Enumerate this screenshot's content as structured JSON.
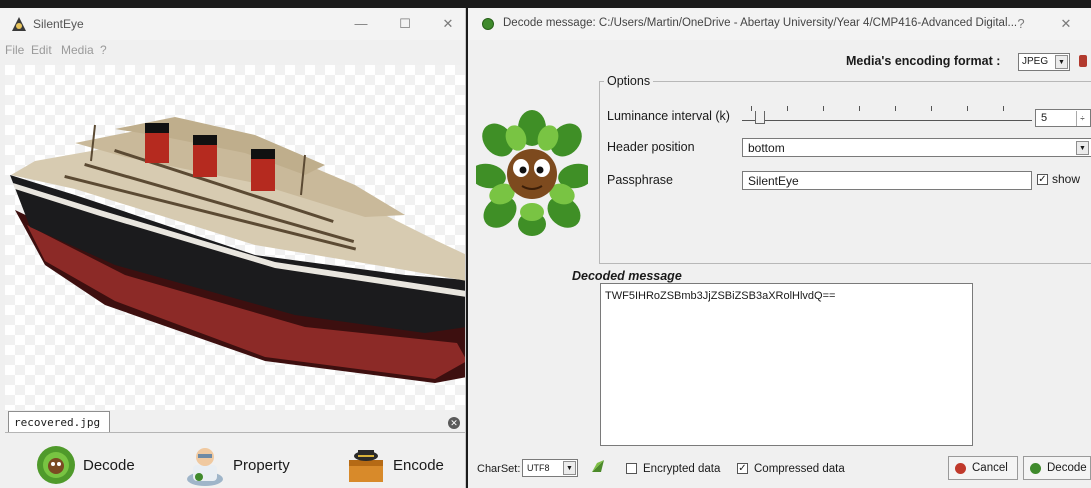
{
  "main_window": {
    "title": "SilentEye",
    "controls": {
      "minimize": "—",
      "maximize": "☐",
      "close": "✕"
    },
    "menu": [
      "File",
      "Edit",
      "Media",
      "?"
    ],
    "file_tab": "recovered.jpg",
    "buttons": {
      "decode": "Decode",
      "property": "Property",
      "encode": "Encode"
    }
  },
  "dialog": {
    "title": "Decode message: C:/Users/Martin/OneDrive - Abertay University/Year 4/CMP416-Advanced Digital...",
    "controls": {
      "help": "?",
      "close": "✕"
    },
    "format_label": "Media's encoding format :",
    "format_value": "JPEG",
    "options": {
      "legend": "Options",
      "luminance_label": "Luminance interval (k)",
      "luminance_value": "5",
      "header_label": "Header position",
      "header_value": "bottom",
      "passphrase_label": "Passphrase",
      "passphrase_value": "SilentEye",
      "show_label": "show",
      "show_checked": true
    },
    "decoded_label": "Decoded message",
    "decoded_text": "TWF5IHRoZSBmb3JjZSBiZSB3aXRolHlvdQ==",
    "charset_label": "CharSet:",
    "charset_value": "UTF8",
    "encrypted_label": "Encrypted data",
    "encrypted_checked": false,
    "compressed_label": "Compressed data",
    "compressed_checked": true,
    "cancel_label": "Cancel",
    "decode_label": "Decode"
  },
  "colors": {
    "window_bg": "#f0f0f0",
    "accent_green": "#3f8a2c",
    "cancel_red": "#c0392b"
  }
}
